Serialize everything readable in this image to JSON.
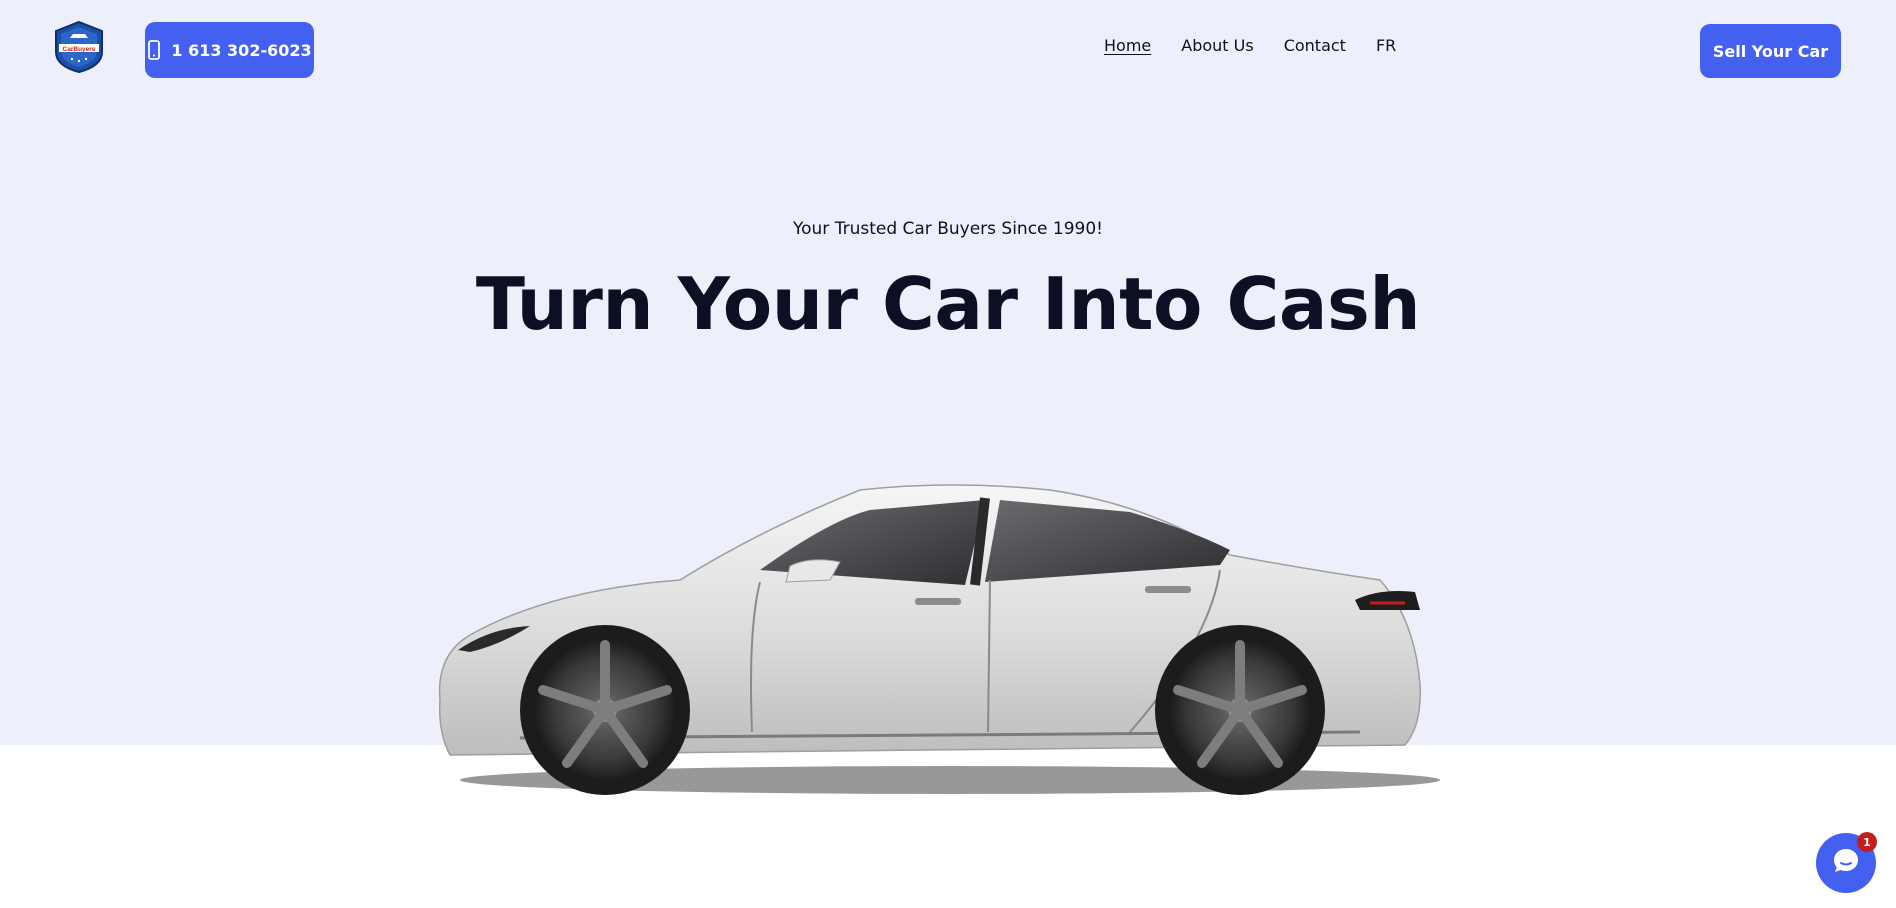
{
  "header": {
    "logo_text": "CarBuyers",
    "phone_label": "1 613 302-6023",
    "nav": [
      "Home",
      "About Us",
      "Contact",
      "FR"
    ],
    "sell_label": "Sell Your Car"
  },
  "hero": {
    "tagline": "Your Trusted Car Buyers Since 1990!",
    "headline": "Turn Your Car Into Cash"
  },
  "chat": {
    "badge_count": "1"
  },
  "colors": {
    "accent": "#4460f1",
    "hero_background": "#edf0fb",
    "text": "#0b1024",
    "badge": "#c41d1d"
  },
  "icons": {
    "phone": "phone-icon",
    "chat": "chat-bubble-icon",
    "logo": "shield-logo"
  }
}
